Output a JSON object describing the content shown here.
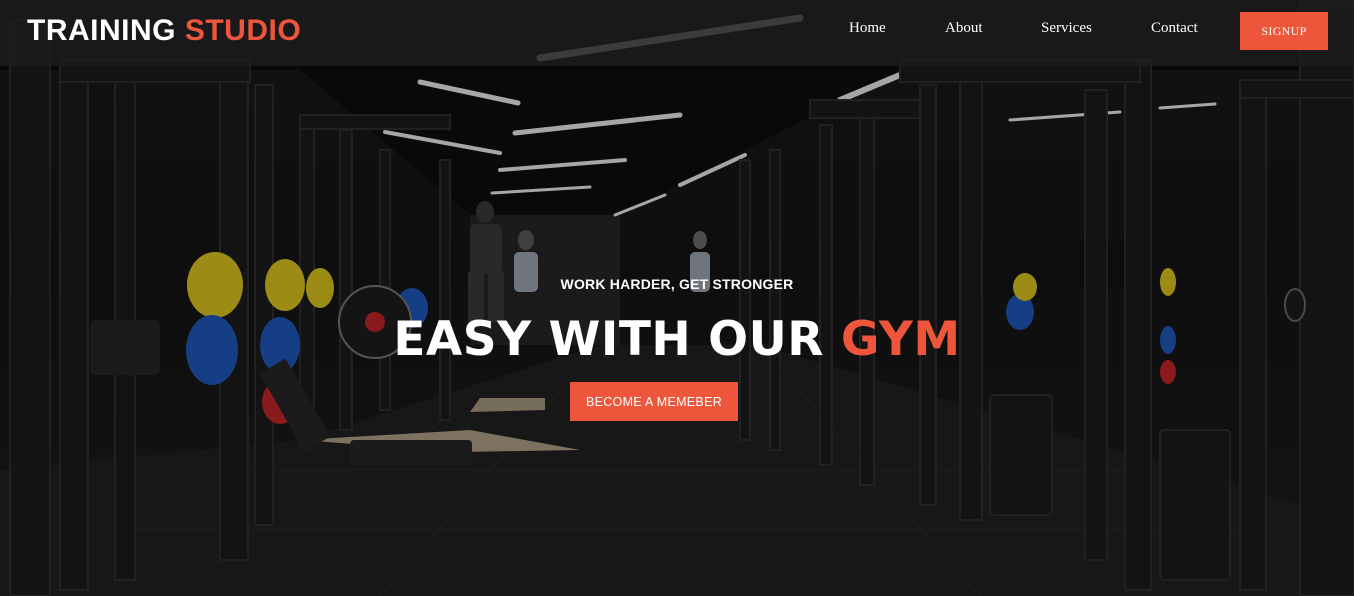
{
  "brand": {
    "logo_primary": "TRAINING",
    "logo_accent": "STUDIO",
    "accent_color": "#ed563b"
  },
  "nav": {
    "items": [
      {
        "label": "Home"
      },
      {
        "label": "About"
      },
      {
        "label": "Services"
      },
      {
        "label": "Contact"
      }
    ],
    "signup_label": "SIGNUP"
  },
  "hero": {
    "tagline": "WORK HARDER, GET STRONGER",
    "headline_main": "EASY WITH OUR",
    "headline_accent": "GYM",
    "cta_label": "BECOME A MEMEBER",
    "background_image": "gym-interior-photo"
  }
}
